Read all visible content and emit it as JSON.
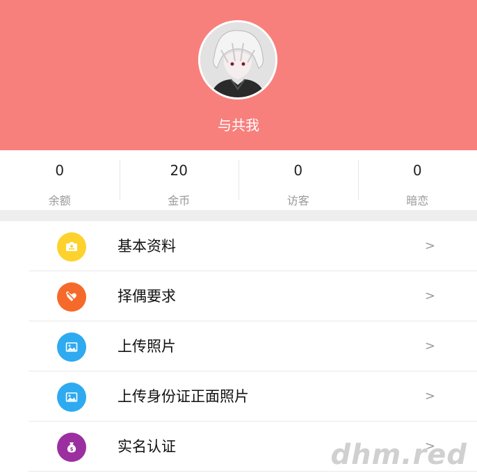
{
  "profile": {
    "nickname": "与共我",
    "header_color": "#f8807c"
  },
  "stats": [
    {
      "value": "0",
      "label": "余额"
    },
    {
      "value": "20",
      "label": "金币"
    },
    {
      "value": "0",
      "label": "访客"
    },
    {
      "value": "0",
      "label": "暗恋"
    }
  ],
  "menu": [
    {
      "label": "基本资料",
      "icon": "id-card-icon",
      "color": "#fdd22c",
      "arrow": ">"
    },
    {
      "label": "择偶要求",
      "icon": "heart-arrow-icon",
      "color": "#f56a2b",
      "arrow": ">"
    },
    {
      "label": "上传照片",
      "icon": "image-icon",
      "color": "#2eaaf0",
      "arrow": ">"
    },
    {
      "label": "上传身份证正面照片",
      "icon": "image-icon",
      "color": "#2eaaf0",
      "arrow": ">"
    },
    {
      "label": "实名认证",
      "icon": "money-bag-icon",
      "color": "#9b2fa0",
      "arrow": ">"
    }
  ],
  "watermark": "dhm.red"
}
